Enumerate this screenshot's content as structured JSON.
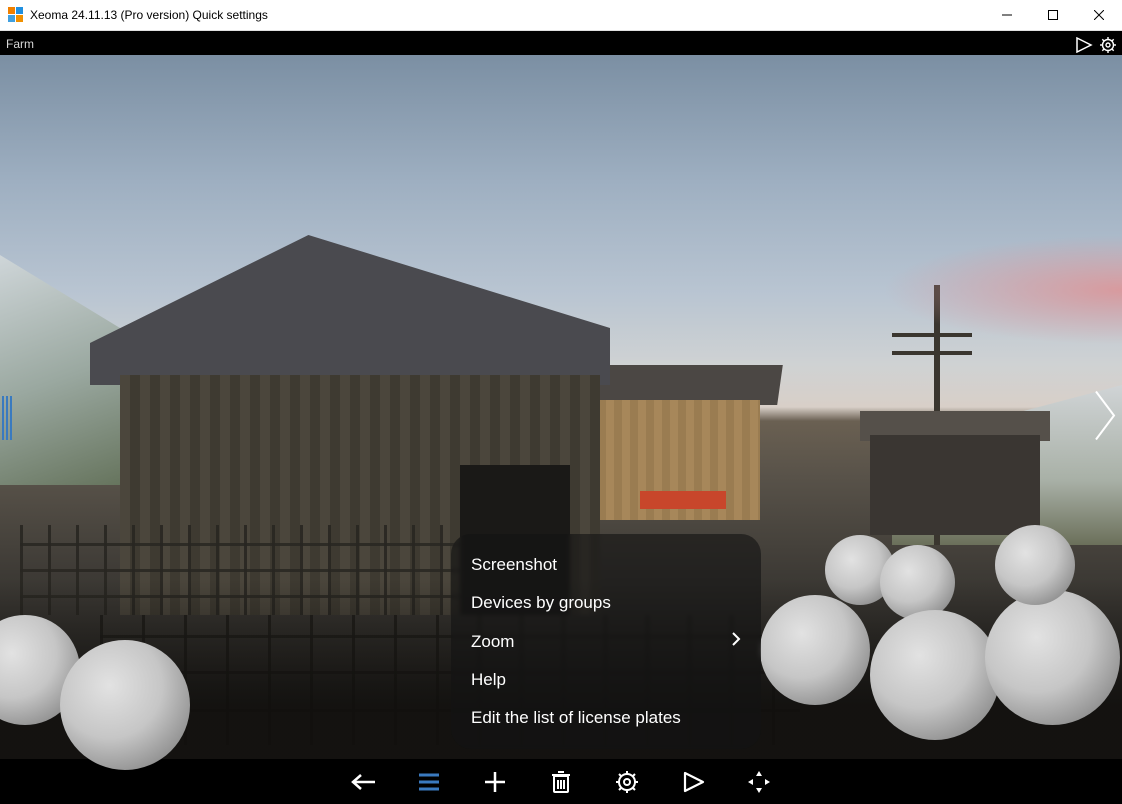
{
  "window": {
    "title": "Xeoma 24.11.13 (Pro version) Quick settings"
  },
  "camera": {
    "label": "Farm"
  },
  "menu": {
    "items": [
      {
        "label": "Screenshot",
        "submenu": false
      },
      {
        "label": "Devices by groups",
        "submenu": false
      },
      {
        "label": "Zoom",
        "submenu": true
      },
      {
        "label": "Help",
        "submenu": false
      },
      {
        "label": "Edit the list of license plates",
        "submenu": false
      }
    ]
  }
}
